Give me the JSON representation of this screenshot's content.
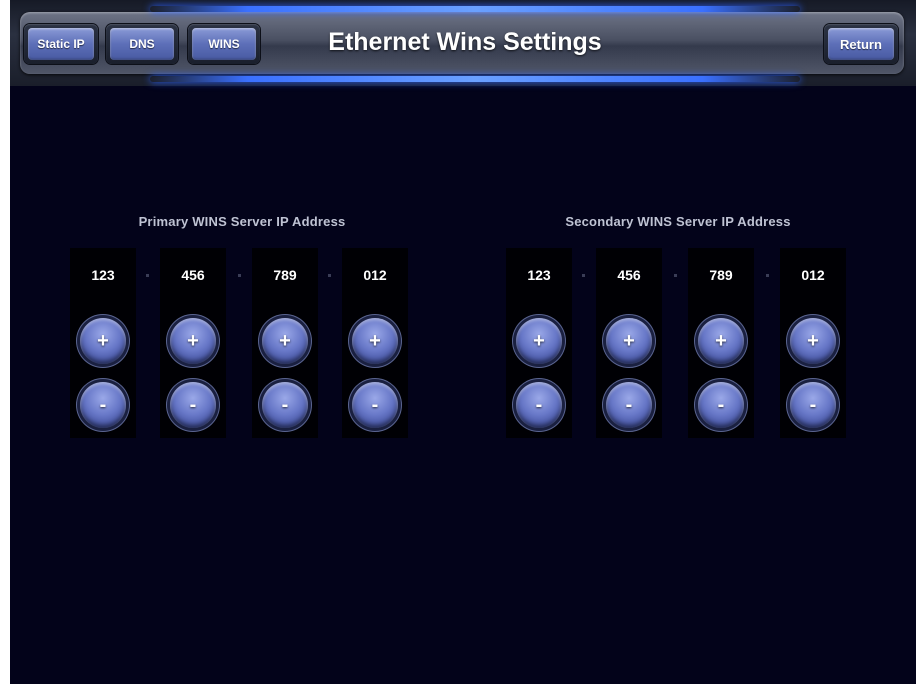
{
  "header": {
    "title": "Ethernet Wins Settings",
    "buttons": {
      "static_ip": "Static IP",
      "dns": "DNS",
      "wins": "WINS",
      "return": "Return"
    }
  },
  "primary": {
    "title": "Primary WINS Server IP Address",
    "octets": [
      "123",
      "456",
      "789",
      "012"
    ]
  },
  "secondary": {
    "title": "Secondary WINS Server IP Address",
    "octets": [
      "123",
      "456",
      "789",
      "012"
    ]
  },
  "controls": {
    "plus": "+",
    "minus": "-"
  },
  "colors": {
    "background": "#03031a",
    "button_face": "#5d6fb8",
    "header_glow": "#3a70ff"
  }
}
